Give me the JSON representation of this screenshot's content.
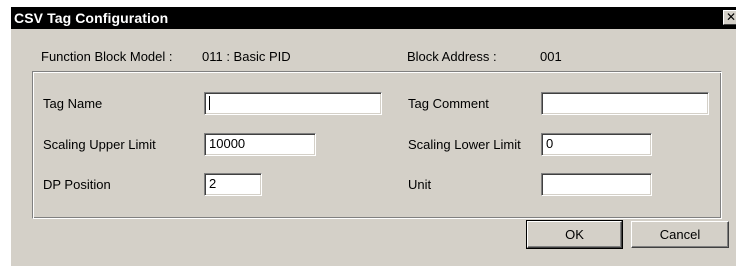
{
  "window": {
    "title": "CSV Tag Configuration",
    "close_glyph": "✕"
  },
  "info": {
    "function_block_model_label": "Function Block Model :",
    "function_block_model_value": "011 : Basic PID",
    "block_address_label": "Block Address :",
    "block_address_value": "001"
  },
  "form": {
    "tag_name_label": "Tag Name",
    "tag_name_value": "",
    "tag_comment_label": "Tag Comment",
    "tag_comment_value": "",
    "scaling_upper_limit_label": "Scaling Upper Limit",
    "scaling_upper_limit_value": "10000",
    "scaling_lower_limit_label": "Scaling Lower Limit",
    "scaling_lower_limit_value": "0",
    "dp_position_label": "DP Position",
    "dp_position_value": "2",
    "unit_label": "Unit",
    "unit_value": ""
  },
  "buttons": {
    "ok_label": "OK",
    "cancel_label": "Cancel"
  },
  "colors": {
    "dialog_face": "#d4d0c8",
    "titlebar": "#000000",
    "title_text": "#ffffff",
    "field_background": "#ffffff"
  }
}
